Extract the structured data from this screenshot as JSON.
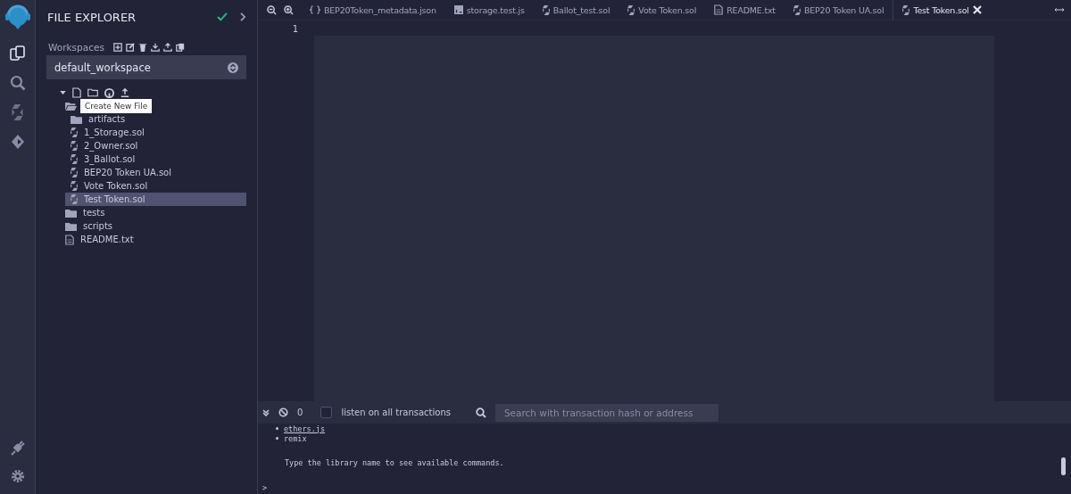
{
  "sidebar": {
    "title": "FILE EXPLORER",
    "workspaces_label": "Workspaces",
    "workspace": "default_workspace",
    "tooltip": "Create New File",
    "tree": [
      {
        "kind": "folder",
        "expanded": true,
        "selected": false,
        "children": [
          {
            "kind": "folder",
            "name": "artifacts",
            "expanded": false,
            "selected": false
          },
          {
            "kind": "sol",
            "name": "1_Storage.sol",
            "selected": false
          },
          {
            "kind": "sol",
            "name": "2_Owner.sol",
            "selected": false
          },
          {
            "kind": "sol",
            "name": "3_Ballot.sol",
            "selected": false
          },
          {
            "kind": "sol",
            "name": "BEP20 Token UA.sol",
            "selected": false
          },
          {
            "kind": "sol",
            "name": "Vote Token.sol",
            "selected": false
          },
          {
            "kind": "sol",
            "name": "Test Token.sol",
            "selected": true
          }
        ]
      },
      {
        "kind": "folder",
        "name": "tests",
        "expanded": false,
        "selected": false
      },
      {
        "kind": "folder",
        "name": "scripts",
        "expanded": false,
        "selected": false
      },
      {
        "kind": "txt",
        "name": "README.txt",
        "selected": false
      }
    ]
  },
  "tabs": [
    {
      "kind": "json",
      "label": "BEP20Token_metadata.json",
      "selected": false
    },
    {
      "kind": "js",
      "label": "storage.test.js",
      "selected": false
    },
    {
      "kind": "sol",
      "label": "Ballot_test.sol",
      "selected": false
    },
    {
      "kind": "sol",
      "label": "Vote Token.sol",
      "selected": false
    },
    {
      "kind": "txt",
      "label": "README.txt",
      "selected": false
    },
    {
      "kind": "sol",
      "label": "BEP20 Token UA.sol",
      "selected": false
    },
    {
      "kind": "sol",
      "label": "Test Token.sol",
      "selected": true
    }
  ],
  "editor": {
    "line_numbers": [
      "1"
    ]
  },
  "terminal": {
    "count": "0",
    "listen_label": "listen on all transactions",
    "listen_checked": false,
    "search_placeholder": "Search with transaction hash or address",
    "lines": [
      {
        "kind": "link",
        "text": "ethers.js"
      },
      {
        "kind": "bullet",
        "text": "remix"
      },
      {
        "kind": "note",
        "text": "Type the library name to see available commands."
      }
    ],
    "prompt": ">"
  }
}
